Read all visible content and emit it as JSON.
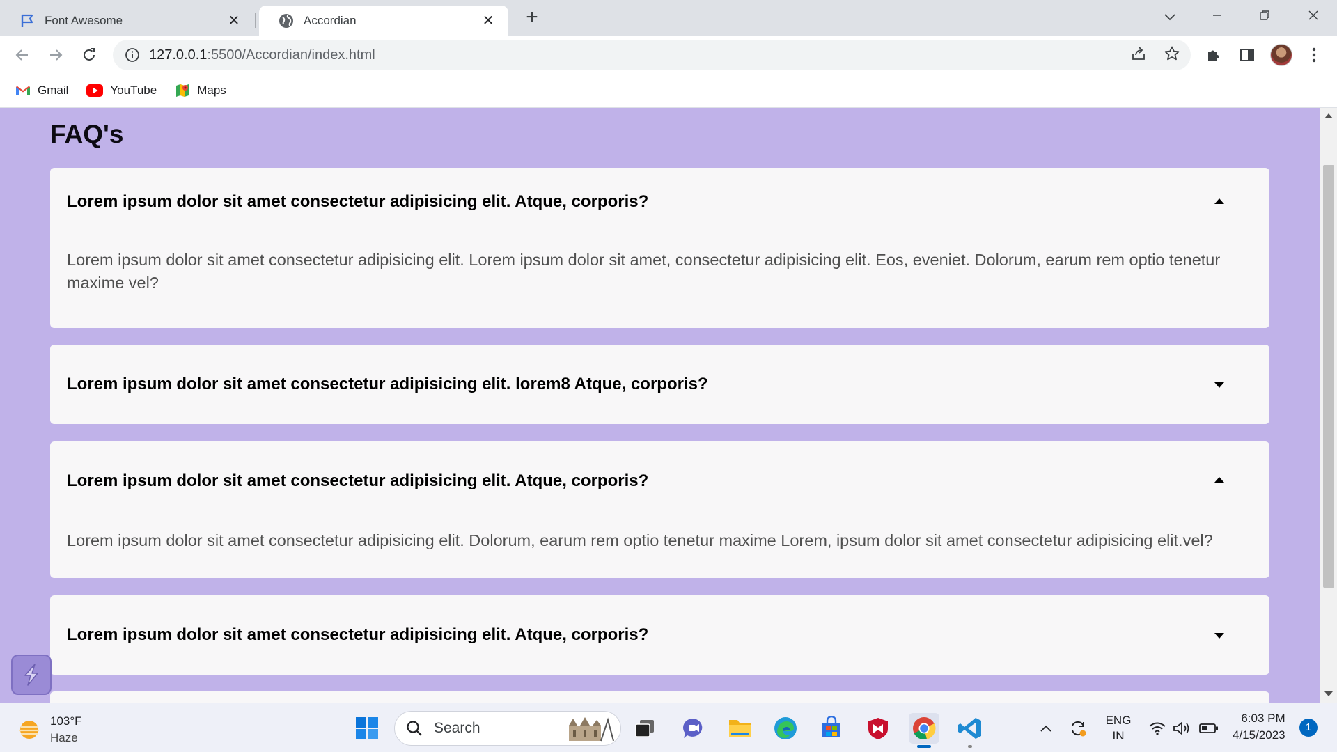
{
  "tabs": [
    {
      "title": "Font Awesome",
      "icon": "flag-icon",
      "active": false
    },
    {
      "title": "Accordian",
      "icon": "globe-icon",
      "active": true
    }
  ],
  "address_bar": {
    "host": "127.0.0.1",
    "path": ":5500/Accordian/index.html"
  },
  "bookmarks": [
    {
      "label": "Gmail",
      "icon": "gmail-icon"
    },
    {
      "label": "YouTube",
      "icon": "youtube-icon"
    },
    {
      "label": "Maps",
      "icon": "maps-icon"
    }
  ],
  "page": {
    "title": "FAQ's",
    "faqs": [
      {
        "question": "Lorem ipsum dolor sit amet consectetur adipisicing elit. Atque, corporis?",
        "answer": "Lorem ipsum dolor sit amet consectetur adipisicing elit. Lorem ipsum dolor sit amet, consectetur adipisicing elit. Eos, eveniet. Dolorum, earum rem optio tenetur maxime vel?",
        "expanded": true
      },
      {
        "question": "Lorem ipsum dolor sit amet consectetur adipisicing elit. lorem8 Atque, corporis?",
        "answer": "",
        "expanded": false
      },
      {
        "question": "Lorem ipsum dolor sit amet consectetur adipisicing elit. Atque, corporis?",
        "answer": "Lorem ipsum dolor sit amet consectetur adipisicing elit. Dolorum, earum rem optio tenetur maxime Lorem, ipsum dolor sit amet consectetur adipisicing elit.vel?",
        "expanded": true
      },
      {
        "question": "Lorem ipsum dolor sit amet consectetur adipisicing elit. Atque, corporis?",
        "answer": "",
        "expanded": false
      }
    ]
  },
  "taskbar": {
    "weather": {
      "temp": "103°F",
      "condition": "Haze"
    },
    "search_label": "Search",
    "tray": {
      "lang_top": "ENG",
      "lang_bottom": "IN"
    },
    "clock": {
      "time": "6:03 PM",
      "date": "4/15/2023"
    },
    "notification_count": "1"
  },
  "colors": {
    "page_bg": "#c0b2e9",
    "card_bg": "#f8f7f8",
    "accent": "#0067c0"
  }
}
